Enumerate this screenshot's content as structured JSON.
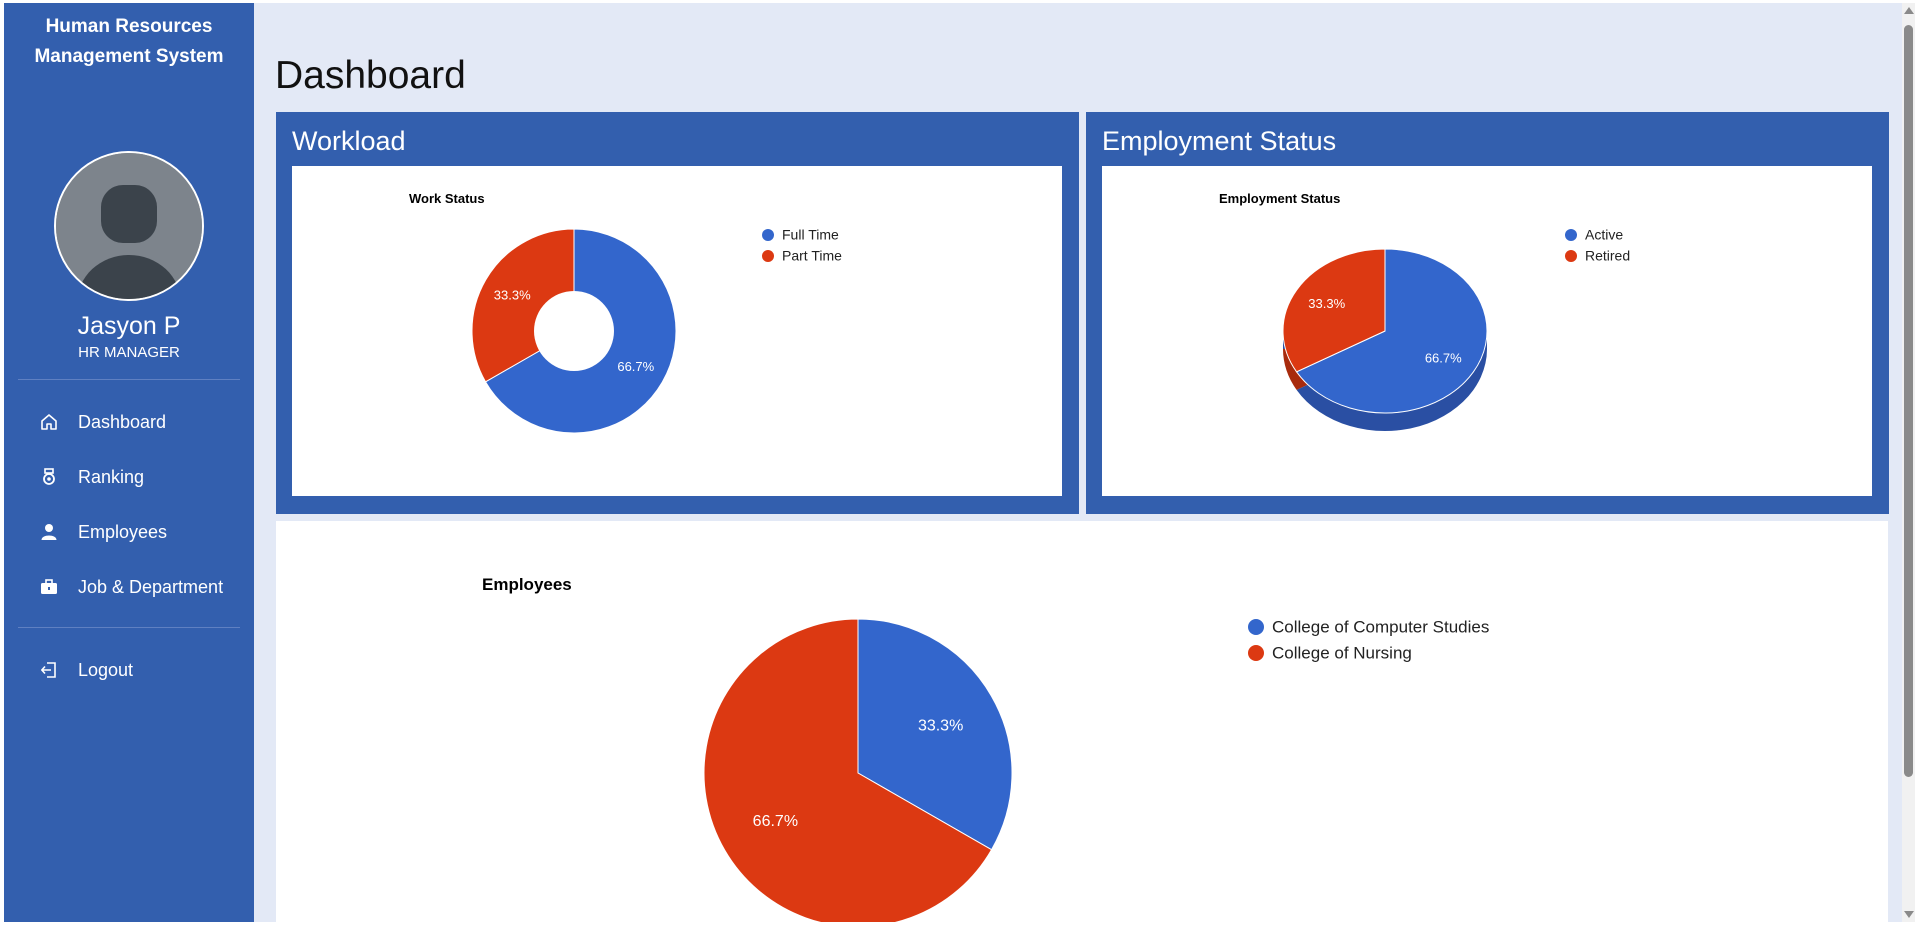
{
  "app": {
    "title_line1": "Human Resources",
    "title_line2": "Management System"
  },
  "user": {
    "name": "Jasyon P",
    "role": "HR MANAGER"
  },
  "nav": [
    {
      "label": "Dashboard",
      "icon": "home-icon"
    },
    {
      "label": "Ranking",
      "icon": "medal-icon"
    },
    {
      "label": "Employees",
      "icon": "person-icon"
    },
    {
      "label": "Job & Department",
      "icon": "briefcase-icon"
    },
    {
      "label": "Logout",
      "icon": "logout-icon"
    }
  ],
  "page": {
    "title": "Dashboard"
  },
  "panels": {
    "workload_title": "Workload",
    "employment_title": "Employment Status"
  },
  "colors": {
    "sidebar": "#335fae",
    "blue": "#3366cc",
    "red": "#dc3912",
    "background": "#e3e9f6"
  },
  "chart_data": [
    {
      "type": "pie",
      "donut": true,
      "title": "Work Status",
      "categories": [
        "Full Time",
        "Part Time"
      ],
      "values": [
        66.7,
        33.3
      ],
      "labels": [
        "66.7%",
        "33.3%"
      ],
      "legend": "right"
    },
    {
      "type": "pie",
      "style": "3d",
      "title": "Employment Status",
      "categories": [
        "Active",
        "Retired"
      ],
      "values": [
        66.7,
        33.3
      ],
      "labels": [
        "66.7%",
        "33.3%"
      ],
      "legend": "right"
    },
    {
      "type": "pie",
      "title": "Employees",
      "categories": [
        "College of Computer Studies",
        "College of Nursing"
      ],
      "values": [
        33.3,
        66.7
      ],
      "labels": [
        "33.3%",
        "66.7%"
      ],
      "legend": "right"
    }
  ]
}
